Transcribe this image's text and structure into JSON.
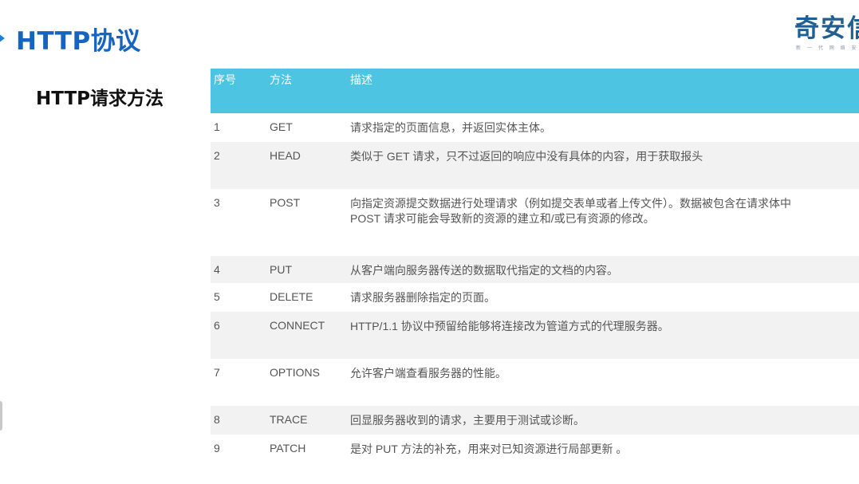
{
  "slide": {
    "title": "HTTP协议",
    "section": "HTTP请求方法"
  },
  "logo": {
    "main": "奇安信",
    "sub": "新 一 代 网 络 安"
  },
  "table": {
    "headers": [
      "序号",
      "方法",
      "描述"
    ],
    "rows": [
      {
        "id": "1",
        "method": "GET",
        "desc": [
          "请求指定的页面信息，并返回实体主体。"
        ]
      },
      {
        "id": "2",
        "method": "HEAD",
        "desc": [
          "类似于 GET 请求，只不过返回的响应中没有具体的内容，用于获取报头"
        ]
      },
      {
        "id": "3",
        "method": "POST",
        "desc": [
          "向指定资源提交数据进行处理请求（例如提交表单或者上传文件）。数据被包含在请求体中",
          "POST 请求可能会导致新的资源的建立和/或已有资源的修改。"
        ]
      },
      {
        "id": "4",
        "method": "PUT",
        "desc": [
          "从客户端向服务器传送的数据取代指定的文档的内容。"
        ]
      },
      {
        "id": "5",
        "method": "DELETE",
        "desc": [
          "请求服务器删除指定的页面。"
        ]
      },
      {
        "id": "6",
        "method": "CONNECT",
        "desc": [
          "HTTP/1.1 协议中预留给能够将连接改为管道方式的代理服务器。"
        ]
      },
      {
        "id": "7",
        "method": "OPTIONS",
        "desc": [
          "允许客户端查看服务器的性能。"
        ]
      },
      {
        "id": "8",
        "method": "TRACE",
        "desc": [
          "回显服务器收到的请求，主要用于测试或诊断。"
        ]
      },
      {
        "id": "9",
        "method": "PATCH",
        "desc": [
          "是对 PUT 方法的补充，用来对已知资源进行局部更新 。"
        ]
      }
    ]
  },
  "colors": {
    "title": "#1565c0",
    "header_bg": "#4cc4e2",
    "logo": "#1f5f93"
  }
}
